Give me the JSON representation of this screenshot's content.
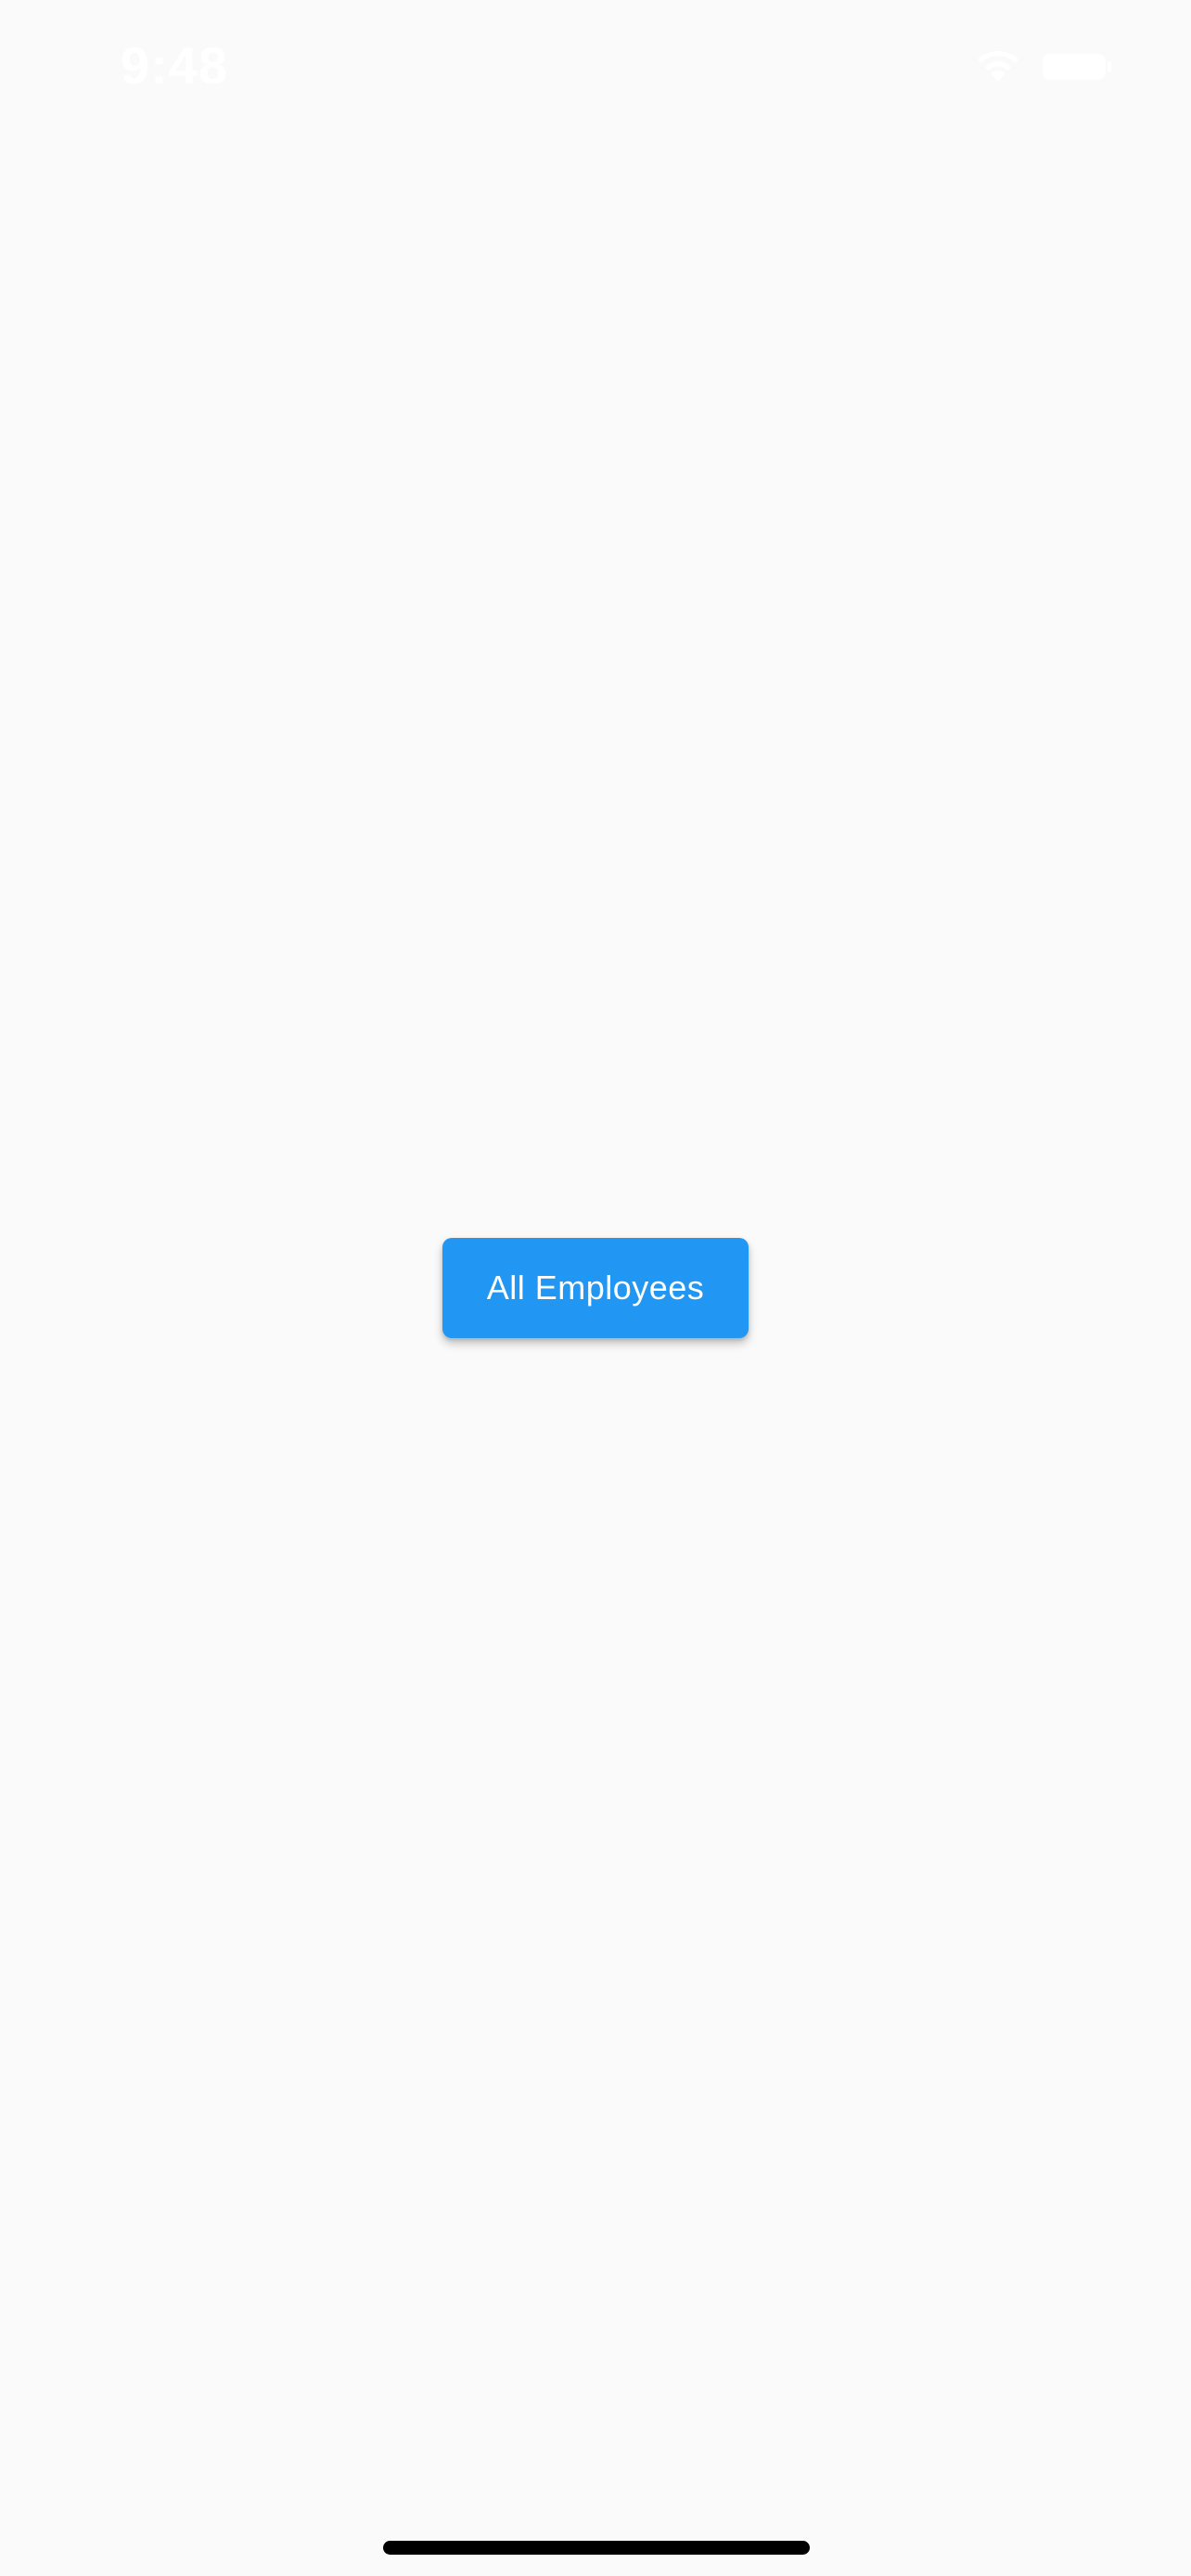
{
  "status_bar": {
    "time": "9:48",
    "wifi_icon": "wifi-icon",
    "battery_icon": "battery-icon"
  },
  "main": {
    "button_label": "All Employees",
    "button_color": "#2196f3"
  },
  "colors": {
    "background": "#fafafa",
    "home_indicator": "#000000"
  }
}
